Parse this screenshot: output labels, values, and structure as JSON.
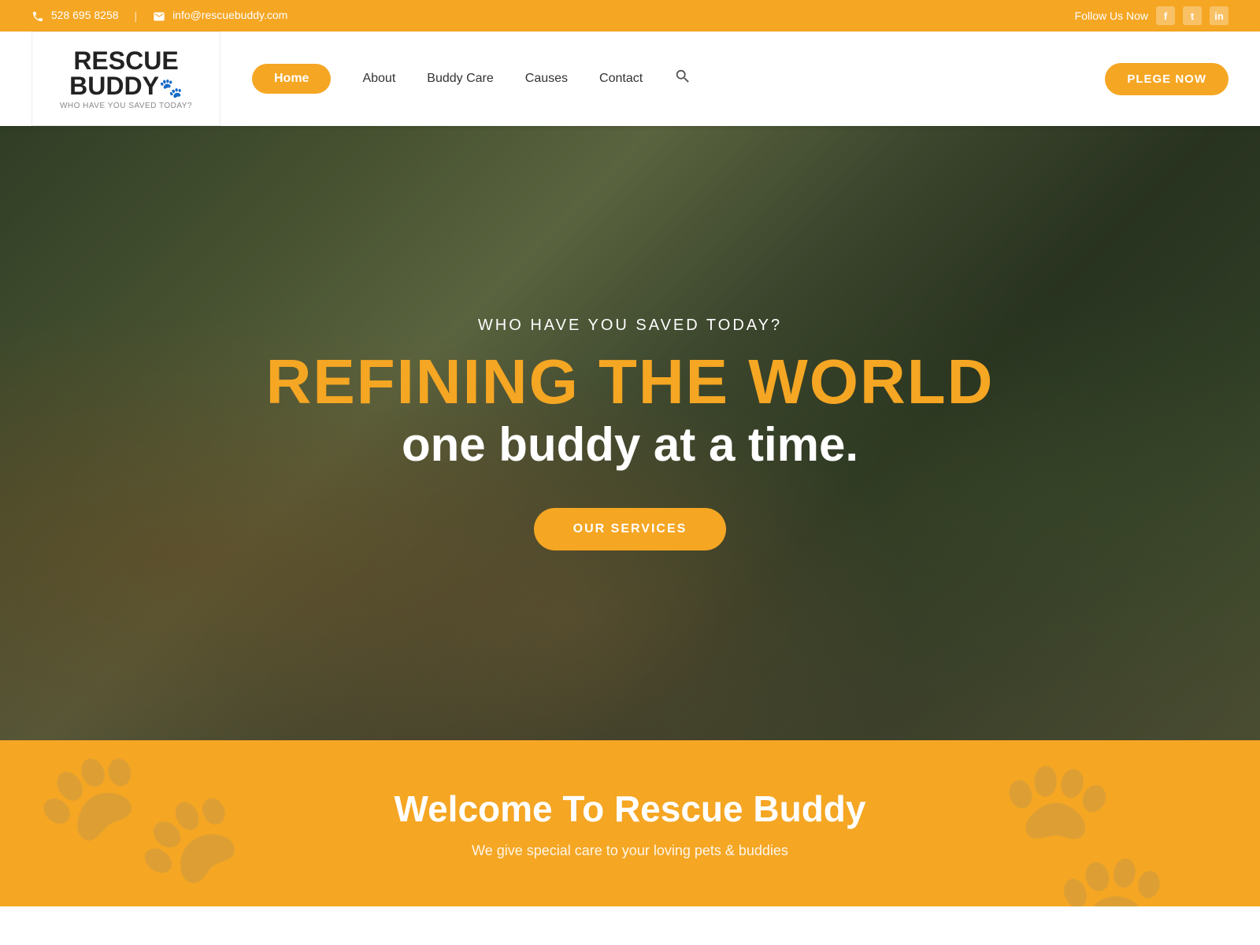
{
  "topbar": {
    "phone": "528 695 8258",
    "email": "info@rescuebuddy.com",
    "follow_text": "Follow Us Now",
    "social": [
      "f",
      "t",
      "in"
    ]
  },
  "header": {
    "logo_line1": "RESCUE",
    "logo_line2": "BUDDY",
    "logo_paw": "🐾",
    "logo_subtitle": "WHO HAVE YOU SAVED TODAY?",
    "nav": [
      {
        "label": "Home",
        "active": true
      },
      {
        "label": "About",
        "active": false
      },
      {
        "label": "Buddy Care",
        "active": false
      },
      {
        "label": "Causes",
        "active": false
      },
      {
        "label": "Contact",
        "active": false
      }
    ],
    "pledge_btn": "PLEGE NOW"
  },
  "hero": {
    "subtitle": "WHO HAVE YOU SAVED TODAY?",
    "title_main": "REFINING THE WORLD",
    "title_sub": "one buddy at a time.",
    "services_btn": "OUR SERVICES"
  },
  "welcome": {
    "title": "Welcome To Rescue Buddy",
    "text": "We give special care to your loving pets & buddies"
  }
}
